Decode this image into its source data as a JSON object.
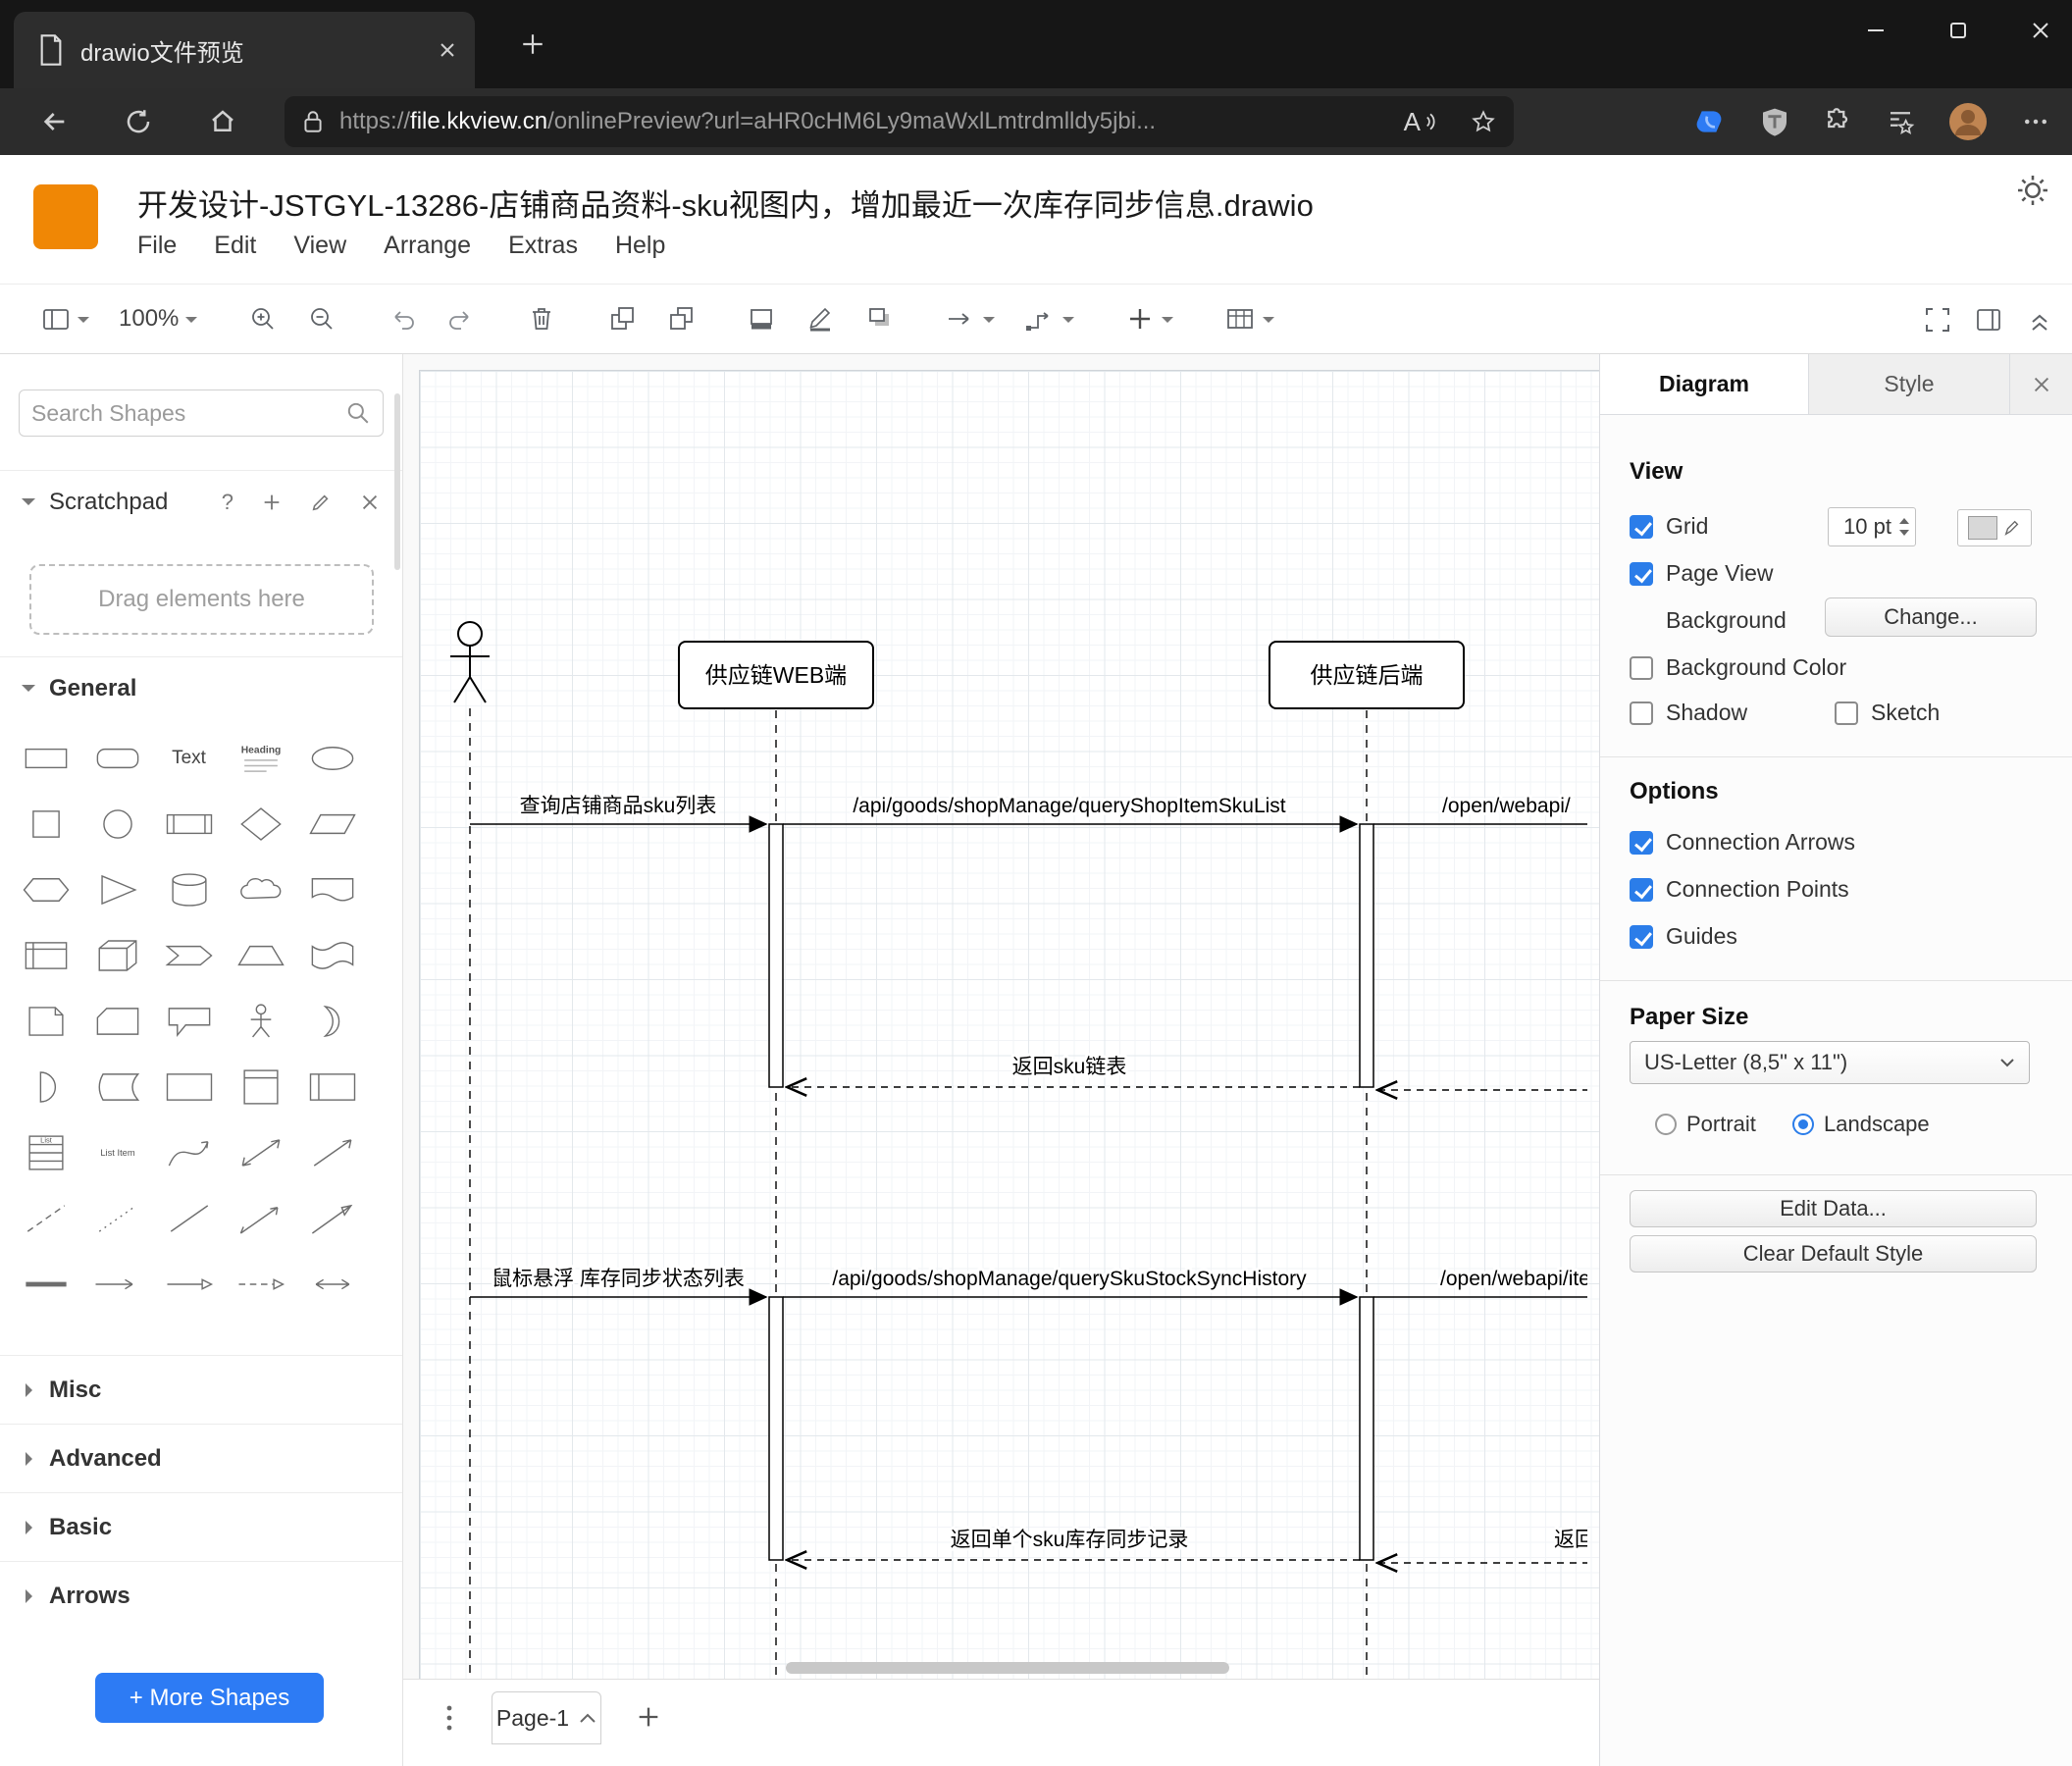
{
  "colors": {
    "accent_blue": "#2d7bf4",
    "checked_blue": "#2b7de9",
    "drawio_orange": "#f08705"
  },
  "browser": {
    "tab_title": "drawio文件预览",
    "url": {
      "scheme": "https://",
      "domain": "file.kkview.cn",
      "path": "/onlinePreview?url=aHR0cHM6Ly9maWxlLmtrdmlldy5jbi..."
    },
    "read_aloud_label": "A"
  },
  "app": {
    "title": "开发设计-JSTGYL-13286-店铺商品资料-sku视图内，增加最近一次库存同步信息.drawio",
    "menus": [
      "File",
      "Edit",
      "View",
      "Arrange",
      "Extras",
      "Help"
    ],
    "zoom_level": "100%"
  },
  "sidebar": {
    "search_placeholder": "Search Shapes",
    "scratchpad": {
      "title": "Scratchpad",
      "help": "?",
      "drag_hint": "Drag elements here"
    },
    "sections": {
      "general": "General",
      "misc": "Misc",
      "advanced": "Advanced",
      "basic": "Basic",
      "arrows": "Arrows"
    },
    "shape_labels": {
      "text": "Text",
      "heading": "Heading",
      "list": "List",
      "list_item": "List Item"
    },
    "more_shapes_label": "+ More Shapes"
  },
  "canvas": {
    "page_tab": "Page-1",
    "diagram": {
      "participants": [
        "供应链WEB端",
        "供应链后端"
      ],
      "messages": [
        "查询店铺商品sku列表",
        "/api/goods/shopManage/queryShopItemSkuList",
        "/open/webapi/",
        "返回sku链表",
        "鼠标悬浮 库存同步状态列表",
        "/api/goods/shopManage/querySkuStockSyncHistory",
        "/open/webapi/item",
        "返回单个sku库存同步记录",
        "返回"
      ]
    }
  },
  "format": {
    "tabs": {
      "diagram": "Diagram",
      "style": "Style"
    },
    "view": {
      "heading": "View",
      "grid": "Grid",
      "grid_size": "10 pt",
      "page_view": "Page View",
      "background": "Background",
      "change": "Change...",
      "background_color": "Background Color",
      "shadow": "Shadow",
      "sketch": "Sketch"
    },
    "options": {
      "heading": "Options",
      "connection_arrows": "Connection Arrows",
      "connection_points": "Connection Points",
      "guides": "Guides"
    },
    "paper": {
      "heading": "Paper Size",
      "size_value": "US-Letter (8,5\" x 11\")",
      "portrait": "Portrait",
      "landscape": "Landscape"
    },
    "edit_data": "Edit Data...",
    "clear_default_style": "Clear Default Style"
  }
}
